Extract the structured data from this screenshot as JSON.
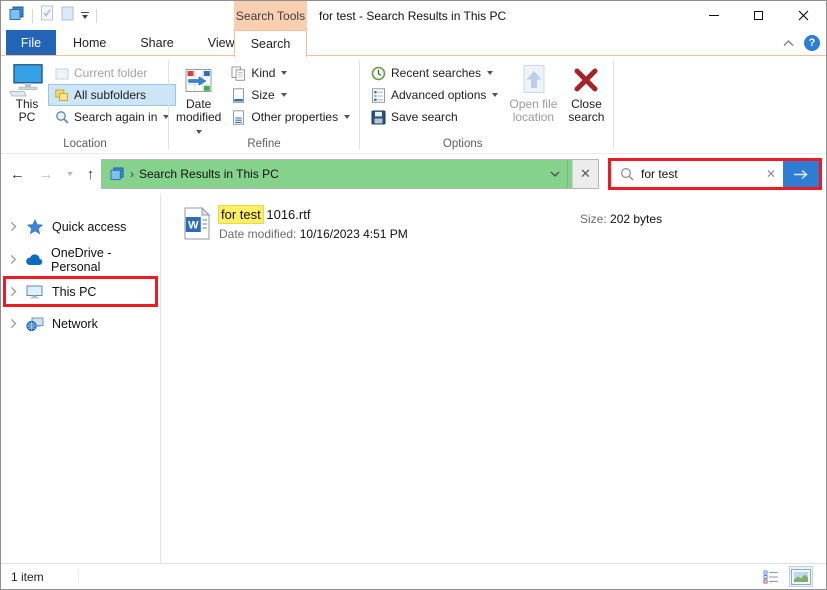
{
  "window": {
    "title": "for test - Search Results in This PC"
  },
  "contextual": {
    "header": "Search Tools",
    "tab": "Search"
  },
  "tabs": [
    {
      "label": "File"
    },
    {
      "label": "Home"
    },
    {
      "label": "Share"
    },
    {
      "label": "View"
    }
  ],
  "ribbon": {
    "location": {
      "label": "Location",
      "this_pc": "This PC",
      "current_folder": "Current folder",
      "all_subfolders": "All subfolders",
      "search_again_in": "Search again in"
    },
    "refine": {
      "label": "Refine",
      "date_modified": "Date modified",
      "kind": "Kind",
      "size": "Size",
      "other_properties": "Other properties"
    },
    "options": {
      "label": "Options",
      "recent_searches": "Recent searches",
      "advanced_options": "Advanced options",
      "save_search": "Save search",
      "open_file_location": "Open file location",
      "close_search": "Close search"
    }
  },
  "address": {
    "path": "Search Results in This PC"
  },
  "search_box": {
    "value": "for test"
  },
  "sidebar": [
    {
      "label": "Quick access"
    },
    {
      "label": "OneDrive - Personal"
    },
    {
      "label": "This PC"
    },
    {
      "label": "Network"
    }
  ],
  "file_item": {
    "name_highlight": "for test",
    "name_rest": " 1016.rtf",
    "date_label": "Date modified:",
    "date_value": "10/16/2023 4:51 PM",
    "size_label": "Size:",
    "size_value": "202 bytes"
  },
  "status": {
    "count": "1 item"
  },
  "icons": {
    "help": "?",
    "back": "←",
    "forward": "→",
    "up": "↑",
    "clear": "✕",
    "stop": "✕",
    "crumb": "›",
    "word_letter": "W"
  },
  "colors": {
    "accent_blue": "#2265b4",
    "contextual_peach": "#f9cfb1",
    "progress_green": "#85d28c",
    "annotation_red": "#ee1b24",
    "selection_blue": "#cde6f7"
  }
}
